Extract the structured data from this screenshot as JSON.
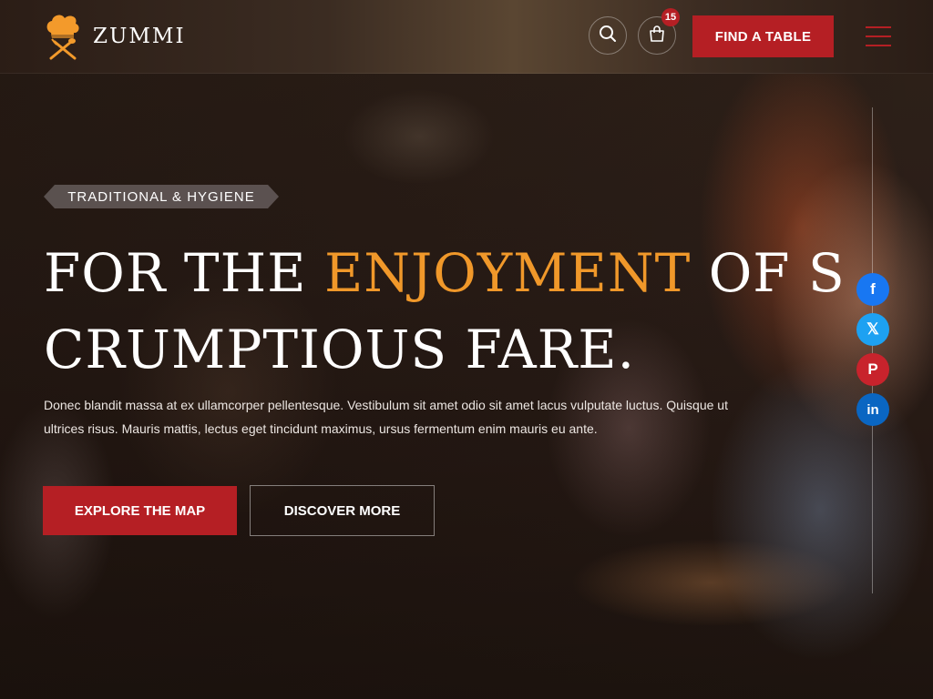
{
  "brand": {
    "name": "ZUMMI",
    "accent_color": "#b51f24",
    "highlight_color": "#f0982a"
  },
  "header": {
    "search_icon": "search-icon",
    "cart_icon": "shopping-bag-icon",
    "cart_count": "15",
    "cta_label": "FIND A TABLE",
    "menu_icon": "hamburger-menu-icon"
  },
  "hero": {
    "tag": "TRADITIONAL & HYGIENE",
    "headline_part1": "FOR THE ",
    "headline_accent": "ENJOYMENT",
    "headline_part2": " OF S CRUMPTIOUS FARE.",
    "description": "Donec blandit massa at ex ullamcorper pellentesque. Vestibulum sit amet odio sit amet lacus vulputate luctus. Quisque ut ultrices risus. Mauris mattis, lectus eget tincidunt maximus, ursus fermentum enim mauris eu ante.",
    "primary_button": "EXPLORE THE MAP",
    "secondary_button": "DISCOVER MORE"
  },
  "social": [
    {
      "name": "facebook-icon",
      "glyph": "f",
      "color": "#1877f2"
    },
    {
      "name": "x-twitter-icon",
      "glyph": "𝕏",
      "color": "#1da1f2"
    },
    {
      "name": "pinterest-icon",
      "glyph": "P",
      "color": "#c8232c"
    },
    {
      "name": "linkedin-icon",
      "glyph": "in",
      "color": "#0a66c2"
    }
  ]
}
